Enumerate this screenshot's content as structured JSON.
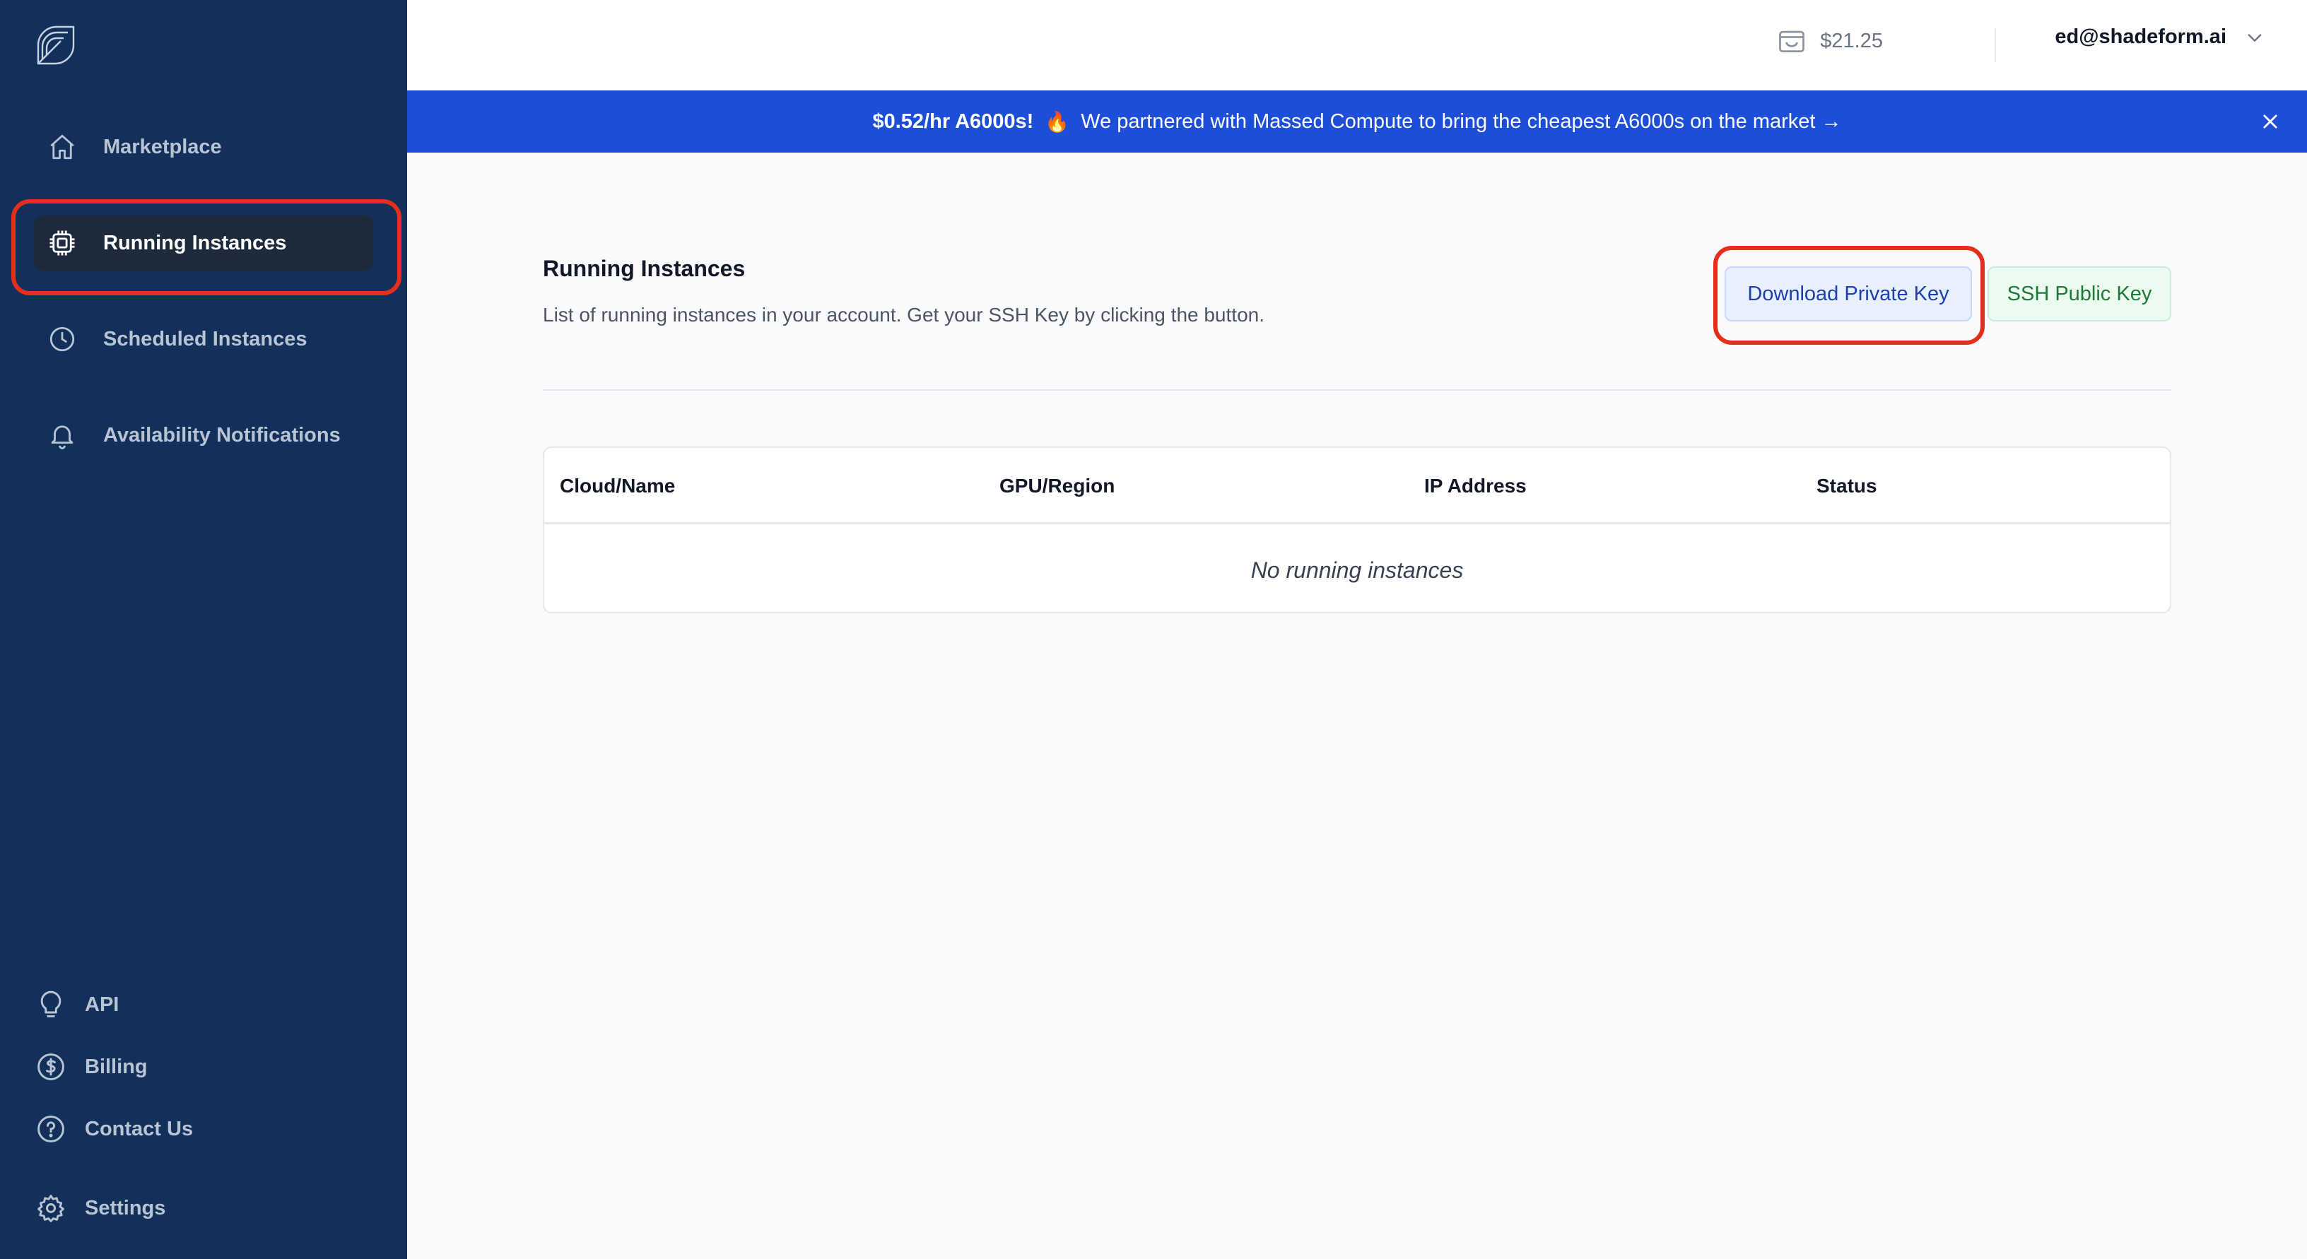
{
  "sidebar": {
    "logo_icon": "shadeform-logo-icon",
    "nav": [
      {
        "label": "Marketplace",
        "icon": "home-icon"
      },
      {
        "label": "Running Instances",
        "icon": "cpu-chip-icon",
        "active": true
      },
      {
        "label": "Scheduled Instances",
        "icon": "clock-icon"
      },
      {
        "label": "Availability Notifications",
        "icon": "bell-icon"
      }
    ],
    "bottom": [
      {
        "label": "API",
        "icon": "lightbulb-icon"
      },
      {
        "label": "Billing",
        "icon": "dollar-circle-icon"
      },
      {
        "label": "Contact Us",
        "icon": "question-circle-icon"
      },
      {
        "label": "Settings",
        "icon": "gear-icon"
      }
    ]
  },
  "header": {
    "balance": "$21.25",
    "user_email": "ed@shadeform.ai"
  },
  "banner": {
    "price": "$0.52/hr A6000s!",
    "fire": "🔥",
    "message": "We partnered with Massed Compute to bring the cheapest A6000s on the market →"
  },
  "main": {
    "title": "Running Instances",
    "description": "List of running instances in your account. Get your SSH Key by clicking the button.",
    "download_button": "Download Private Key",
    "ssh_button": "SSH Public Key",
    "table": {
      "columns": [
        "Cloud/Name",
        "GPU/Region",
        "IP Address",
        "Status"
      ],
      "empty_message": "No running instances"
    }
  },
  "colors": {
    "sidebar_bg": "#12305a",
    "banner_bg": "#1d4ed8",
    "highlight": "#e62e1c"
  }
}
